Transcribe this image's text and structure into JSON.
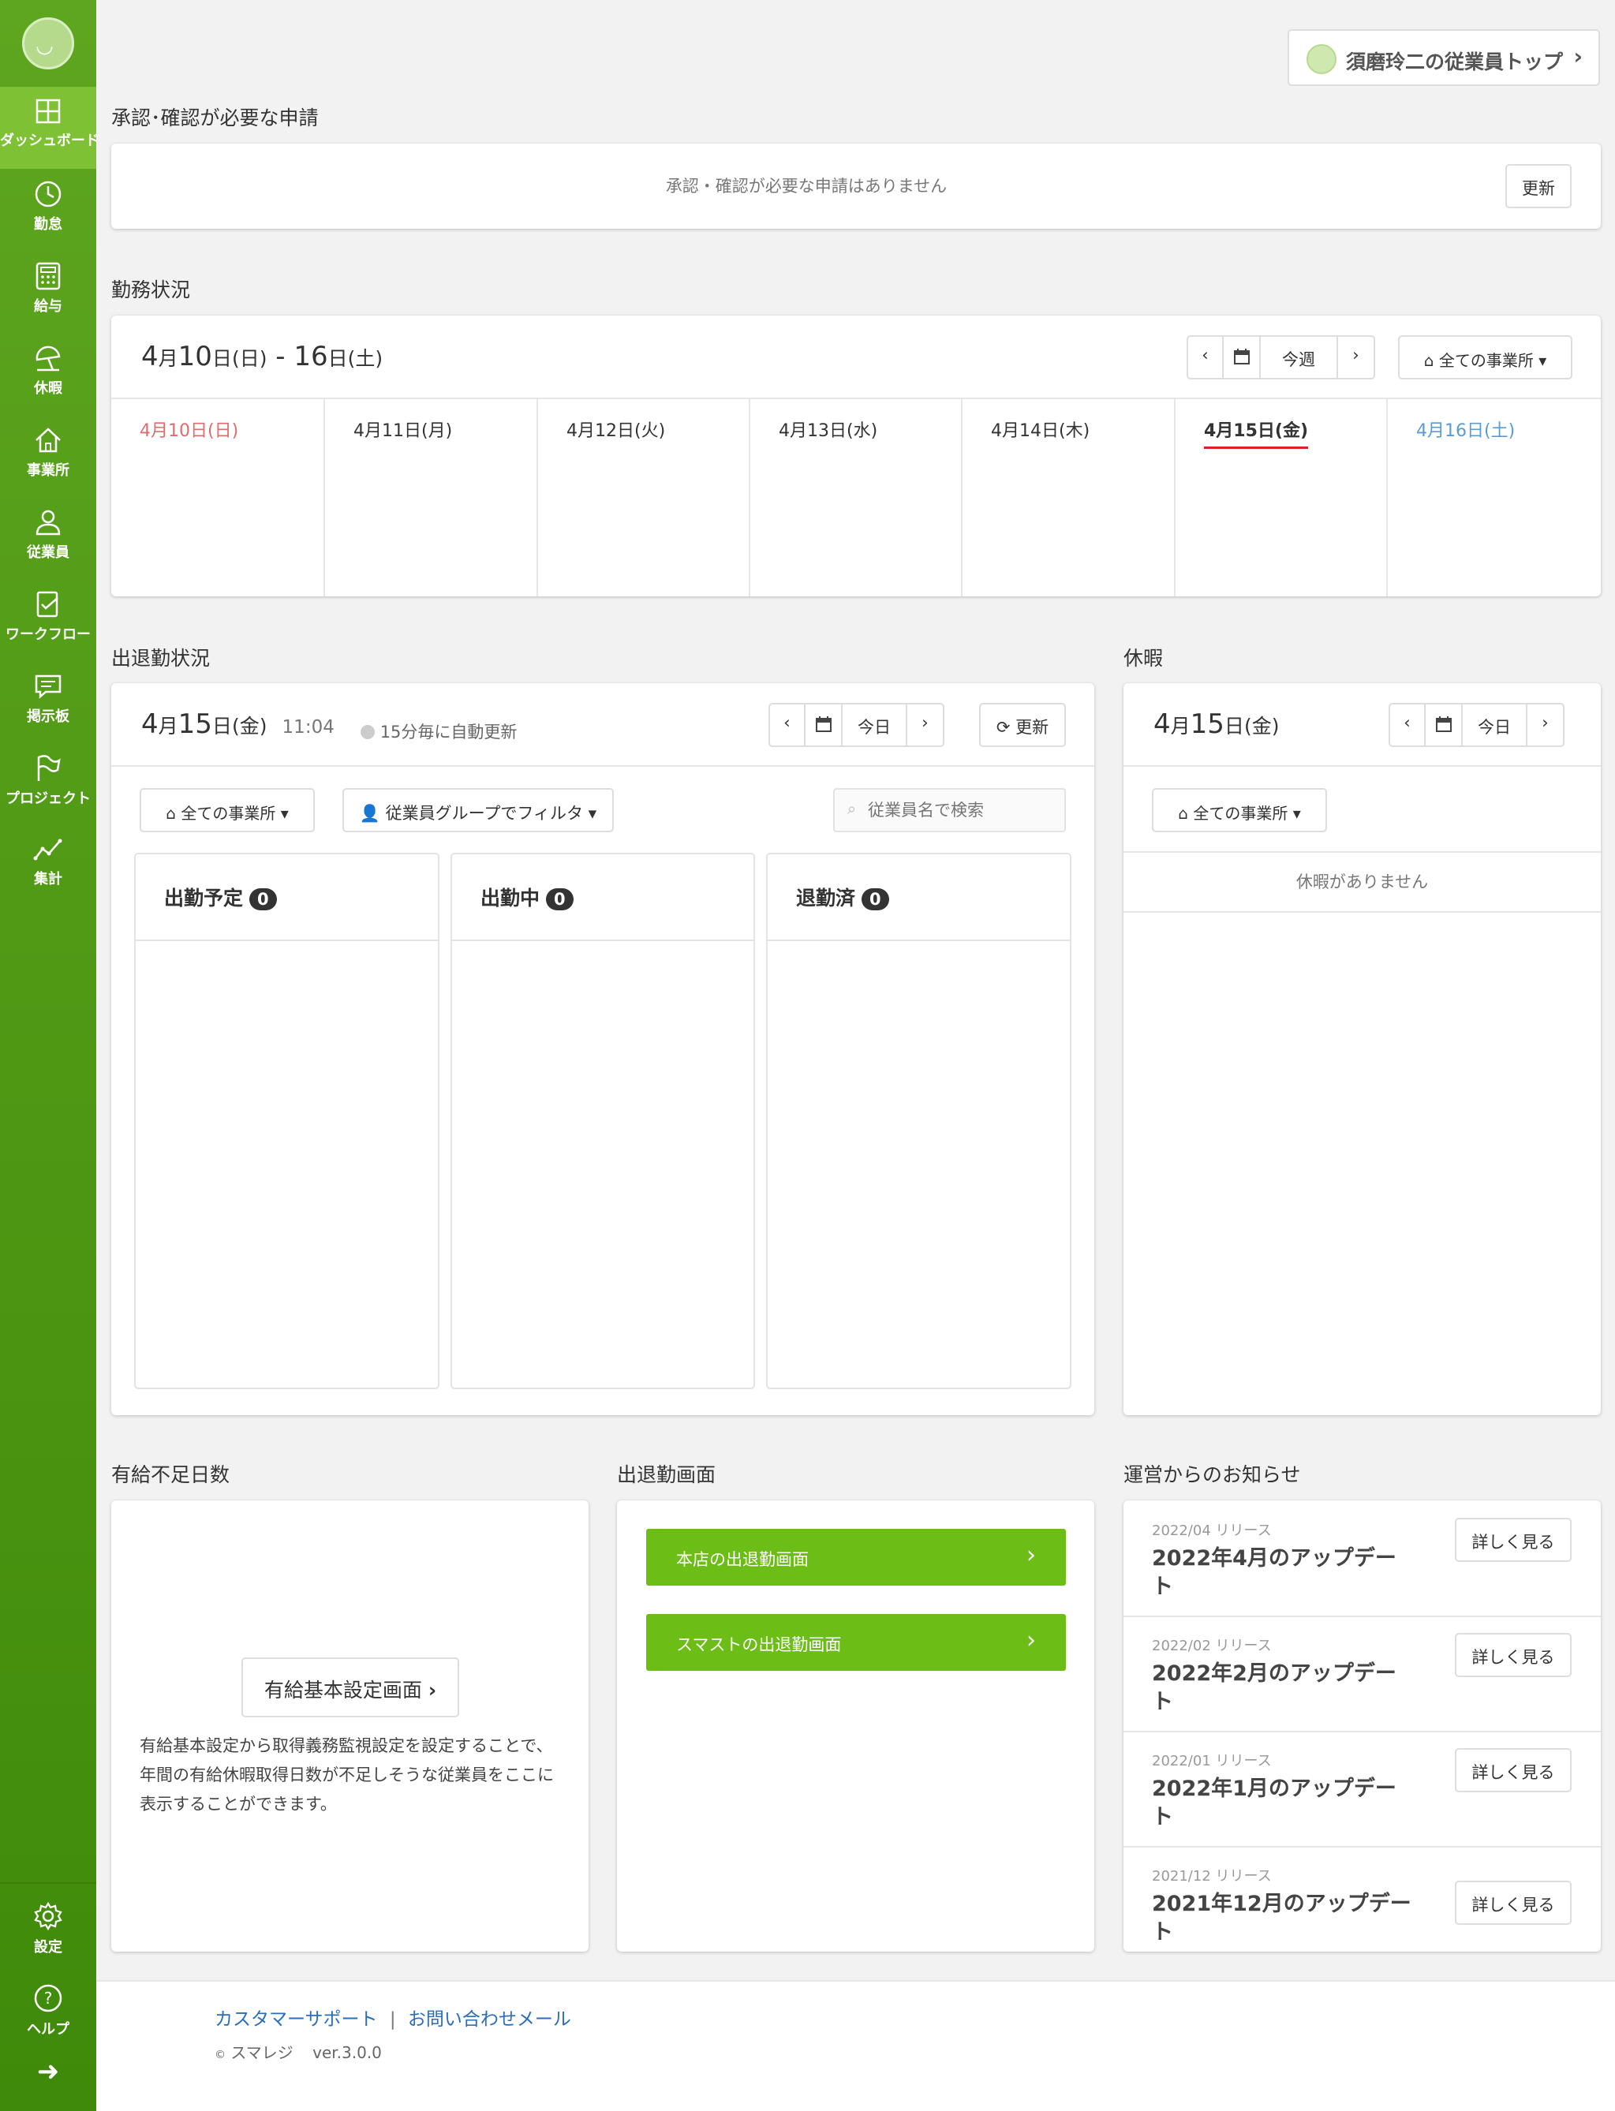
{
  "sidebar": {
    "items": [
      {
        "label": "ダッシュボード",
        "icon": "dashboard-icon"
      },
      {
        "label": "勤怠",
        "icon": "clock-icon"
      },
      {
        "label": "給与",
        "icon": "calculator-icon"
      },
      {
        "label": "休暇",
        "icon": "umbrella-icon"
      },
      {
        "label": "事業所",
        "icon": "home-icon"
      },
      {
        "label": "従業員",
        "icon": "user-icon"
      },
      {
        "label": "ワークフロー",
        "icon": "workflow-icon"
      },
      {
        "label": "掲示板",
        "icon": "chat-icon"
      },
      {
        "label": "プロジェクト",
        "icon": "flag-icon"
      },
      {
        "label": "集計",
        "icon": "chart-icon"
      }
    ],
    "settings": "設定",
    "help": "ヘルプ",
    "expand": "➜"
  },
  "header": {
    "employee_top": "須磨玲二の従業員トップ"
  },
  "approval": {
    "title": "承認･確認が必要な申請",
    "empty": "承認・確認が必要な申請はありません",
    "refresh": "更新"
  },
  "work": {
    "title": "勤務状況",
    "range": {
      "m1": "4",
      "mk1": "月",
      "d1": "10",
      "dk1": "日",
      "w1": "(日)",
      "sep": " - ",
      "d2": "16",
      "dk2": "日",
      "w2": "(土)"
    },
    "this_week": "今週",
    "office": "全ての事業所",
    "days": [
      "4月10日(日)",
      "4月11日(月)",
      "4月12日(火)",
      "4月13日(水)",
      "4月14日(木)",
      "4月15日(金)",
      "4月16日(土)"
    ]
  },
  "attendance": {
    "title": "出退勤状況",
    "date": {
      "m": "4",
      "mk": "月",
      "d": "15",
      "dk": "日",
      "w": "(金)"
    },
    "time": "11:04",
    "auto": "15分毎に自動更新",
    "today": "今日",
    "refresh": "更新",
    "office": "全ての事業所",
    "group": "従業員グループでフィルタ",
    "search_placeholder": "従業員名で検索",
    "cols": [
      {
        "label": "出勤予定",
        "count": "0"
      },
      {
        "label": "出勤中",
        "count": "0"
      },
      {
        "label": "退勤済",
        "count": "0"
      }
    ]
  },
  "vacation": {
    "title": "休暇",
    "date": {
      "m": "4",
      "mk": "月",
      "d": "15",
      "dk": "日",
      "w": "(金)"
    },
    "today": "今日",
    "office": "全ての事業所",
    "empty": "休暇がありません"
  },
  "paid": {
    "title": "有給不足日数",
    "button": "有給基本設定画面",
    "desc": "有給基本設定から取得義務監視設定を設定することで、年間の有給休暇取得日数が不足しそうな従業員をここに表示することができます。"
  },
  "clock": {
    "title": "出退勤画面",
    "buttons": [
      "本店の出退勤画面",
      "スマストの出退勤画面"
    ]
  },
  "news": {
    "title": "運営からのお知らせ",
    "detail": "詳しく見る",
    "items": [
      {
        "release": "2022/04 リリース",
        "title": "2022年4月のアップデート"
      },
      {
        "release": "2022/02 リリース",
        "title": "2022年2月のアップデート"
      },
      {
        "release": "2022/01 リリース",
        "title": "2022年1月のアップデート"
      },
      {
        "release": "2021/12 リリース",
        "title": "2021年12月のアップデート"
      }
    ]
  },
  "footer": {
    "support": "カスタマーサポート",
    "sep": "|",
    "mail": "お問い合わせメール",
    "copy": "©",
    "company": "スマレジ",
    "version": "ver.3.0.0"
  },
  "colors": {
    "sidebar": "#4e9a12",
    "active": "#7ec135",
    "green_button": "#6cbd15",
    "sunday": "#e06c6c",
    "saturday": "#5b9bd5",
    "today_underline": "#e02020",
    "link": "#2a6ebb"
  }
}
